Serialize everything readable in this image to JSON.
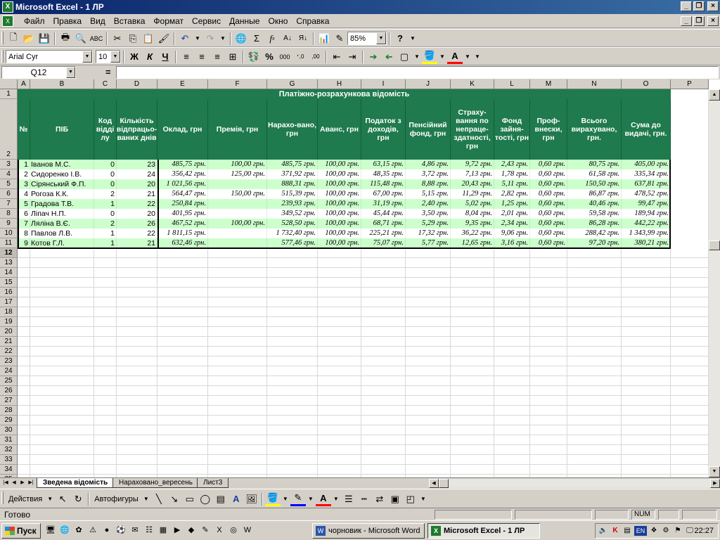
{
  "window": {
    "title": "Microsoft Excel - 1 ЛР",
    "btn_minimize": "_",
    "btn_restore": "❐",
    "btn_close": "×"
  },
  "menu": [
    "Файл",
    "Правка",
    "Вид",
    "Вставка",
    "Формат",
    "Сервис",
    "Данные",
    "Окно",
    "Справка"
  ],
  "toolbar": {
    "zoom": "85%",
    "font": "Arial Cyr",
    "font_size": "10",
    "bold": "Ж",
    "italic": "К",
    "underline": "Ч",
    "percent": "%",
    "thousands": "000",
    "inc_decimal": "⁺,0",
    "dec_decimal": ",00",
    "sigma": "Σ",
    "fx": "f",
    "help": "?"
  },
  "formula_bar": {
    "name_box": "Q12",
    "equals": "=",
    "content": ""
  },
  "grid": {
    "columns": [
      "A",
      "B",
      "C",
      "D",
      "E",
      "F",
      "G",
      "H",
      "I",
      "J",
      "K",
      "L",
      "M",
      "N",
      "O",
      "P"
    ],
    "rows": [
      "1",
      "2",
      "3",
      "4",
      "5",
      "6",
      "7",
      "8",
      "9",
      "10",
      "11",
      "12",
      "13",
      "14",
      "15",
      "16",
      "17",
      "18",
      "19",
      "20",
      "21",
      "22",
      "23",
      "24",
      "25",
      "26",
      "27",
      "28",
      "29",
      "30",
      "31",
      "32",
      "33",
      "34",
      "35"
    ],
    "selected_row": "12"
  },
  "sheet": {
    "title": "Платіжно-розрахункова відомість",
    "headers": [
      "№",
      "ПІБ",
      "Код відді лу",
      "Кількість відпрацьо-ваних днів",
      "Оклад, грн",
      "Премія, грн",
      "Нарахо-вано, грн",
      "Аванс, грн",
      "Податок з доходів, грн",
      "Пенсійний фонд, грн",
      "Страху-вання по непраце-здатності, грн",
      "Фонд зайня-тості, грн",
      "Проф-внески, грн",
      "Всього вирахувано, грн.",
      "Сума до видачі, грн."
    ],
    "rows": [
      [
        "1",
        "Іванов М.С.",
        "0",
        "23",
        "485,75 грн.",
        "100,00 грн.",
        "485,75 грн.",
        "100,00 грн.",
        "63,15 грн.",
        "4,86 грн.",
        "9,72 грн.",
        "2,43 грн.",
        "0,60 грн.",
        "80,75 грн.",
        "405,00 грн."
      ],
      [
        "2",
        "Сидоренко І.В.",
        "0",
        "24",
        "356,42 грн.",
        "125,00 грн.",
        "371,92 грн.",
        "100,00 грн.",
        "48,35 грн.",
        "3,72 грн.",
        "7,13 грн.",
        "1,78 грн.",
        "0,60 грн.",
        "61,58 грн.",
        "335,34 грн."
      ],
      [
        "3",
        "Сірянський Ф.П.",
        "0",
        "20",
        "1 021,56 грн.",
        "",
        "888,31 грн.",
        "100,00 грн.",
        "115,48 грн.",
        "8,88 грн.",
        "20,43 грн.",
        "5,11 грн.",
        "0,60 грн.",
        "150,50 грн.",
        "637,81 грн."
      ],
      [
        "4",
        "Рогоза К.К.",
        "2",
        "21",
        "564,47 грн.",
        "150,00 грн.",
        "515,39 грн.",
        "100,00 грн.",
        "67,00 грн.",
        "5,15 грн.",
        "11,29 грн.",
        "2,82 грн.",
        "0,60 грн.",
        "86,87 грн.",
        "478,52 грн."
      ],
      [
        "5",
        "Градова Т.В.",
        "1",
        "22",
        "250,84 грн.",
        "",
        "239,93 грн.",
        "100,00 грн.",
        "31,19 грн.",
        "2,40 грн.",
        "5,02 грн.",
        "1,25 грн.",
        "0,60 грн.",
        "40,46 грн.",
        "99,47 грн."
      ],
      [
        "6",
        "Ліпач Н.П.",
        "0",
        "20",
        "401,95 грн.",
        "",
        "349,52 грн.",
        "100,00 грн.",
        "45,44 грн.",
        "3,50 грн.",
        "8,04 грн.",
        "2,01 грн.",
        "0,60 грн.",
        "59,58 грн.",
        "189,94 грн."
      ],
      [
        "7",
        "Ляліна В.Є.",
        "2",
        "26",
        "467,52 грн.",
        "100,00 грн.",
        "528,50 грн.",
        "100,00 грн.",
        "68,71 грн.",
        "5,29 грн.",
        "9,35 грн.",
        "2,34 грн.",
        "0,60 грн.",
        "86,28 грн.",
        "442,22 грн."
      ],
      [
        "8",
        "Павлов Л.В.",
        "1",
        "22",
        "1 811,15 грн.",
        "",
        "1 732,40 грн.",
        "100,00 грн.",
        "225,21 грн.",
        "17,32 грн.",
        "36,22 грн.",
        "9,06 грн.",
        "0,60 грн.",
        "288,42 грн.",
        "1 343,99 грн."
      ],
      [
        "9",
        "Котов Г.Л.",
        "1",
        "21",
        "632,46 грн.",
        "",
        "577,46 грн.",
        "100,00 грн.",
        "75,07 грн.",
        "5,77 грн.",
        "12,65 грн.",
        "3,16 грн.",
        "0,60 грн.",
        "97,20 грн.",
        "380,21 грн."
      ]
    ]
  },
  "tabs": [
    "Зведена відомість",
    "Нараховано_вересень",
    "Лист3"
  ],
  "drawing": {
    "actions": "Действия",
    "autoshapes": "Автофигуры"
  },
  "status": {
    "ready": "Готово",
    "num": "NUM"
  },
  "taskbar": {
    "start": "Пуск",
    "items": [
      "чорновик - Microsoft Word",
      "Microsoft Excel - 1 ЛР"
    ],
    "lang": "EN",
    "clock": "22:27"
  },
  "colors": {
    "header_green": "#1f7a4d",
    "row_light_green": "#ccffcc",
    "title_bar": "#0a246a"
  }
}
